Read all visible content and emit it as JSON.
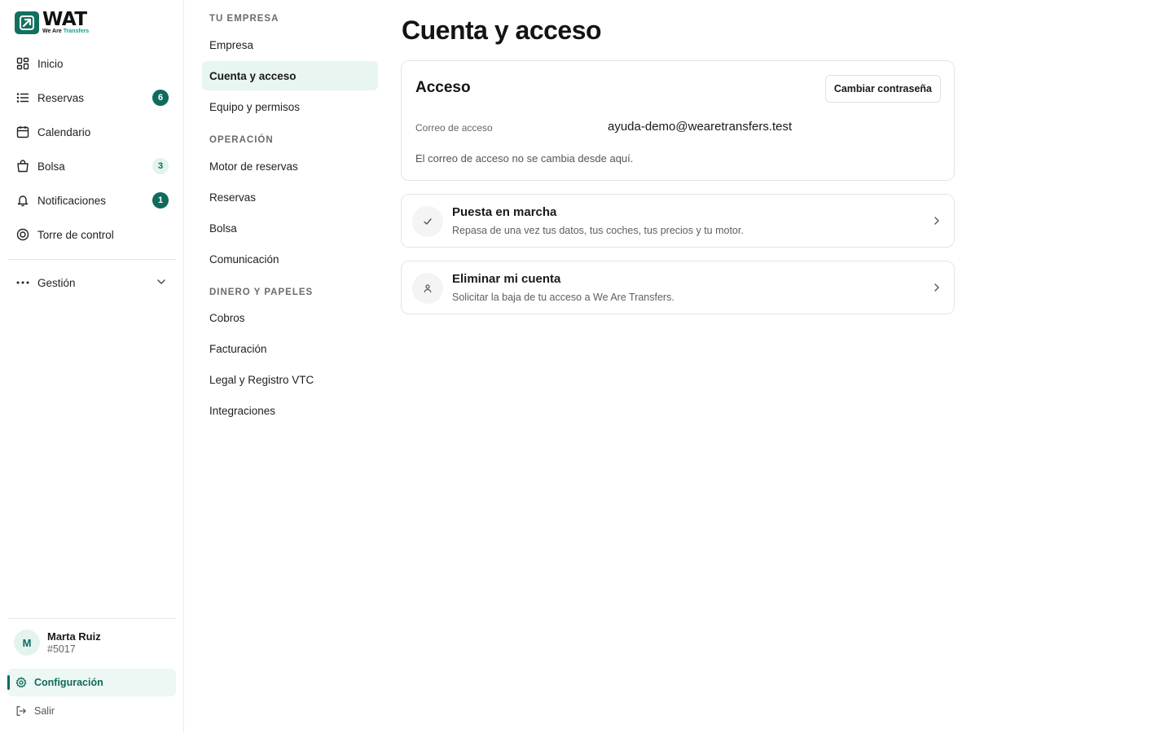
{
  "brand": {
    "name": "WAT",
    "tagline_prefix": "We Are",
    "tagline_suffix": "Transfers",
    "primary_color": "#0f6b5b"
  },
  "sidebar": {
    "items": [
      {
        "label": "Inicio",
        "icon": "grid-icon"
      },
      {
        "label": "Reservas",
        "icon": "list-icon",
        "badge": "6"
      },
      {
        "label": "Calendario",
        "icon": "calendar-icon"
      },
      {
        "label": "Bolsa",
        "icon": "bag-icon",
        "badge": "3"
      },
      {
        "label": "Notificaciones",
        "icon": "bell-icon",
        "badge": "1"
      },
      {
        "label": "Torre de control",
        "icon": "target-icon"
      }
    ],
    "gestion_label": "Gestión",
    "user": {
      "initial": "M",
      "name": "Marta Ruiz",
      "id": "#5017"
    },
    "config_label": "Configuración",
    "logout_label": "Salir"
  },
  "subnav": {
    "sections": [
      {
        "title": "TU EMPRESA",
        "items": [
          "Empresa",
          "Cuenta y acceso",
          "Equipo y permisos"
        ]
      },
      {
        "title": "OPERACIÓN",
        "items": [
          "Motor de reservas",
          "Reservas",
          "Bolsa",
          "Comunicación"
        ]
      },
      {
        "title": "DINERO Y PAPELES",
        "items": [
          "Cobros",
          "Facturación",
          "Legal y Registro VTC",
          "Integraciones"
        ]
      }
    ],
    "active": "Cuenta y acceso"
  },
  "main": {
    "title": "Cuenta y acceso",
    "acceso": {
      "title": "Acceso",
      "change_password_label": "Cambiar contraseña",
      "email_label": "Correo de acceso",
      "email_value": "ayuda-demo@wearetransfers.test",
      "note": "El correo de acceso no se cambia desde aquí."
    },
    "setup": {
      "title": "Puesta en marcha",
      "description": "Repasa de una vez tus datos, tus coches, tus precios y tu motor."
    },
    "delete": {
      "title": "Eliminar mi cuenta",
      "description": "Solicitar la baja de tu acceso a We Are Transfers."
    }
  }
}
